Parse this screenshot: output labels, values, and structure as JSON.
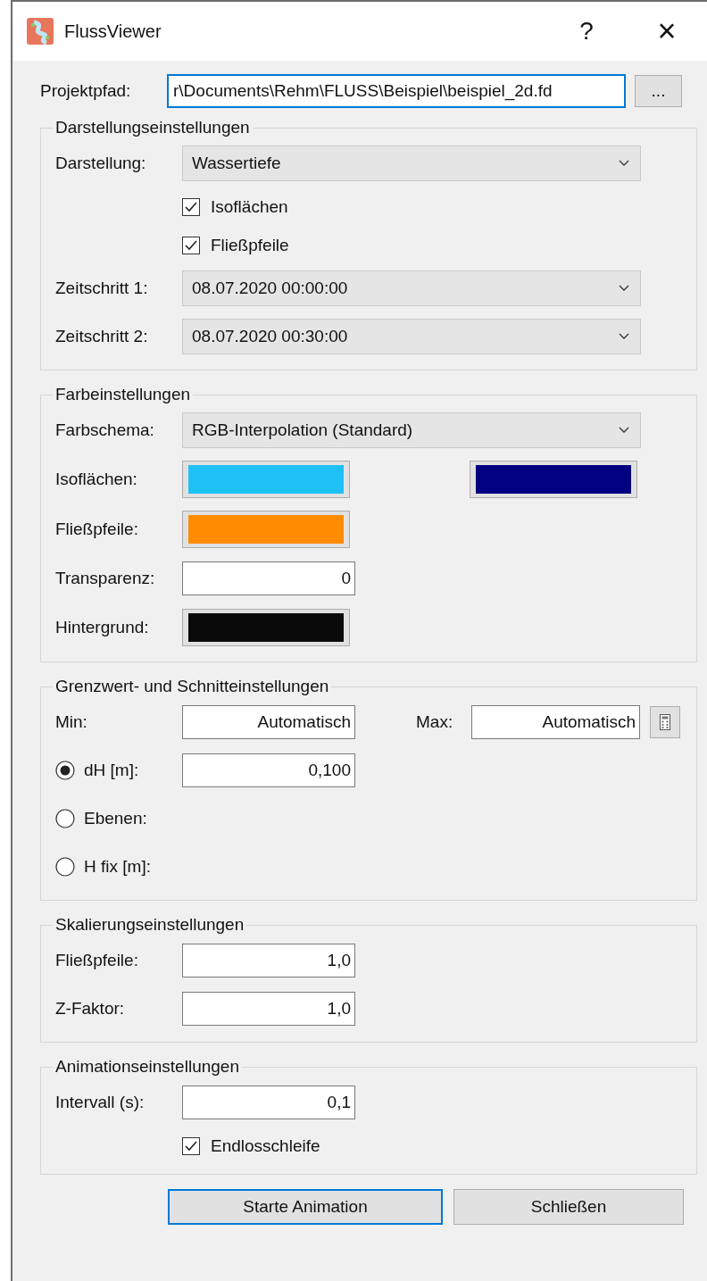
{
  "window": {
    "title": "FlussViewer",
    "help": "?",
    "close": "×"
  },
  "project_path": {
    "label": "Projektpfad:",
    "value": "r\\Documents\\Rehm\\FLUSS\\Beispiel\\beispiel_2d.fd",
    "browse": "..."
  },
  "groups": [
    {
      "title": "Darstellungseinstellungen",
      "rows": [
        {
          "kind": "select",
          "label": "Darstellung:",
          "value": "Wassertiefe"
        },
        {
          "kind": "checkbox",
          "label": "Isoflächen",
          "checked": true
        },
        {
          "kind": "checkbox",
          "label": "Fließpfeile",
          "checked": true
        },
        {
          "kind": "select",
          "label": "Zeitschritt 1:",
          "value": "08.07.2020 00:00:00"
        },
        {
          "kind": "select",
          "label": "Zeitschritt 2:",
          "value": "08.07.2020 00:30:00"
        }
      ]
    },
    {
      "title": "Farbeinstellungen",
      "rows": [
        {
          "kind": "select",
          "label": "Farbschema:",
          "value": "RGB-Interpolation (Standard)"
        },
        {
          "kind": "colors",
          "label": "Isoflächen:",
          "colors": [
            {
              "color": "#1ec1f5"
            },
            {
              "color": "#000080"
            }
          ]
        },
        {
          "kind": "colors",
          "label": "Fließpfeile:",
          "colors": [
            {
              "color": "#ff8c00"
            }
          ]
        },
        {
          "kind": "input",
          "label": "Transparenz:",
          "value": "0"
        },
        {
          "kind": "colors",
          "label": "Hintergrund:",
          "colors": [
            {
              "color": "#0a0a0a"
            }
          ]
        }
      ]
    },
    {
      "title": "Grenzwert- und Schnitteinstellungen",
      "rows": [
        {
          "kind": "minmax",
          "label": "Min:",
          "value": "Automatisch",
          "label2": "Max:",
          "value2": "Automatisch"
        },
        {
          "kind": "radio",
          "label": "dH [m]:",
          "selected": true,
          "value": "0,100"
        },
        {
          "kind": "radio",
          "label": "Ebenen:",
          "selected": false
        },
        {
          "kind": "radio",
          "label": "H fix [m]:",
          "selected": false
        }
      ]
    },
    {
      "title": "Skalierungseinstellungen",
      "rows": [
        {
          "kind": "input",
          "label": "Fließpfeile:",
          "value": "1,0"
        },
        {
          "kind": "input",
          "label": "Z-Faktor:",
          "value": "1,0"
        }
      ]
    },
    {
      "title": "Animationseinstellungen",
      "rows": [
        {
          "kind": "input",
          "label": "Intervall (s):",
          "value": "0,1"
        },
        {
          "kind": "checkbox",
          "label": "Endlosschleife",
          "checked": true
        }
      ]
    }
  ],
  "buttons": [
    {
      "label": "Starte Animation",
      "default": true
    },
    {
      "label": "Schließen",
      "default": false
    }
  ]
}
